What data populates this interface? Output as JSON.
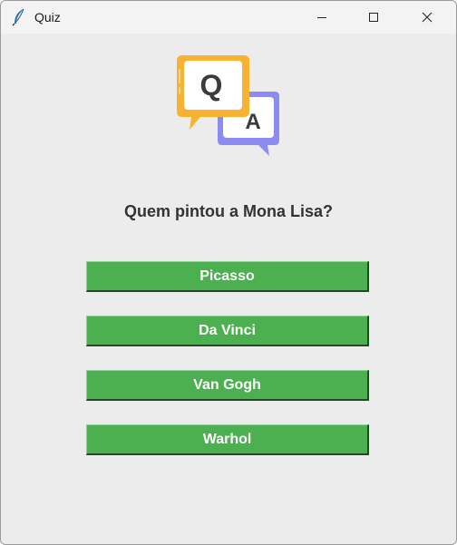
{
  "window": {
    "title": "Quiz"
  },
  "logo": {
    "q_letter": "Q",
    "a_letter": "A",
    "q_color": "#f8b232",
    "a_color": "#8c8cf0"
  },
  "quiz": {
    "question": "Quem pintou a Mona Lisa?",
    "answers": [
      "Picasso",
      "Da Vinci",
      "Van Gogh",
      "Warhol"
    ],
    "button_color": "#4caf50"
  }
}
